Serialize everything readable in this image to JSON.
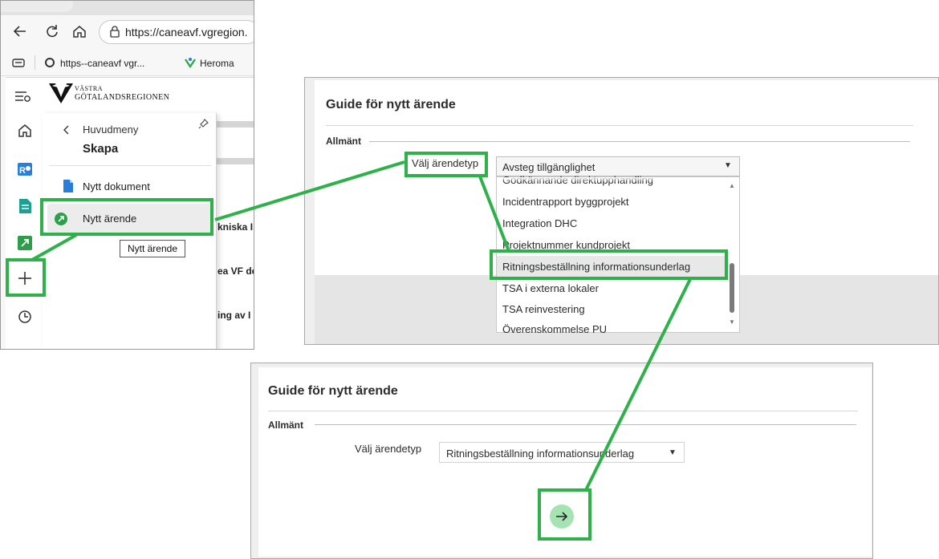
{
  "browser": {
    "url": "https://caneavf.vgregion.",
    "bookmarks": [
      "https--caneavf vgr...",
      "Heroma"
    ],
    "logo_line1": "VÄSTRA",
    "logo_line2": "GÖTALANDSREGIONEN",
    "menu": {
      "back_label": "Huvudmeny",
      "title": "Skapa",
      "items": [
        "Nytt dokument",
        "Nytt ärende"
      ],
      "tooltip": "Nytt ärende"
    },
    "background_snippets": [
      "kniska I",
      "ea VF dc",
      "ing av I"
    ],
    "icons": [
      "back-icon",
      "refresh-icon",
      "home-icon",
      "lock-icon",
      "pin-icon",
      "sidebar-collapse-icon",
      "plus-icon",
      "history-icon"
    ]
  },
  "guide_open": {
    "title": "Guide för nytt ärende",
    "section": "Allmänt",
    "field_label": "Välj ärendetyp",
    "selected": "Avsteg tillgänglighet",
    "options": [
      "Godkännande direktupphandling",
      "Incidentrapport byggprojekt",
      "Integration DHC",
      "Projektnummer kundprojekt",
      "Ritningsbeställning informationsunderlag",
      "TSA i externa lokaler",
      "TSA reinvestering",
      "Överenskommelse PU"
    ],
    "highlighted_option": "Ritningsbeställning informationsunderlag"
  },
  "guide_selected": {
    "title": "Guide för nytt ärende",
    "section": "Allmänt",
    "field_label": "Välj ärendetyp",
    "selected": "Ritningsbeställning informationsunderlag",
    "next_icon": "arrow-right-icon"
  },
  "colors": {
    "annotation_green": "#2fb14a",
    "next_button": "#a6e3b2"
  }
}
